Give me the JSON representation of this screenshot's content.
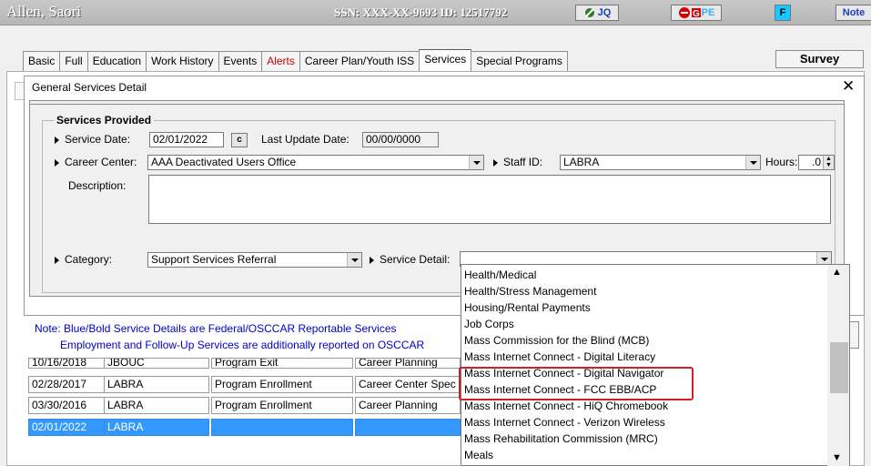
{
  "header": {
    "name": "Allen, Saori",
    "ssn_id": "SSN:  XXX-XX-9693 ID: 12517792",
    "btn_jq": "JQ",
    "btn_pe": "PE",
    "btn_f": "F",
    "btn_notes": "Note"
  },
  "tabs": [
    "Basic",
    "Full",
    "Education",
    "Work History",
    "Events",
    "Alerts",
    "Career Plan/Youth ISS",
    "Services",
    "Special Programs"
  ],
  "survey_label": "Survey",
  "dialog": {
    "title": "General Services Detail",
    "close": "✕",
    "group_title": "Services Provided",
    "service_date_label": "Service Date:",
    "service_date_value": "02/01/2022",
    "cal_btn": "c",
    "last_update_label": "Last Update Date:",
    "last_update_value": "00/00/0000",
    "career_center_label": "Career Center:",
    "career_center_value": "AAA Deactivated Users Office",
    "staff_label": "Staff ID:",
    "staff_value": "LABRA",
    "hours_label": "Hours:",
    "hours_value": ".0",
    "description_label": "Description:",
    "description_value": "",
    "category_label": "Category:",
    "category_value": "Support Services Referral",
    "service_detail_label": "Service Detail:",
    "service_detail_value": ""
  },
  "notes": [
    "Note: Blue/Bold Service Details are Federal/OSCCAR Reportable Services",
    "Employment and Follow-Up Services are additionally reported on OSCCAR"
  ],
  "grid_rows": [
    {
      "date": "10/16/2018",
      "staff": "JBOUC",
      "type": "Program Exit",
      "cat": "Career Planning"
    },
    {
      "date": "02/28/2017",
      "staff": "LABRA",
      "type": "Program Enrollment",
      "cat": "Career Center Spec"
    },
    {
      "date": "03/30/2016",
      "staff": "LABRA",
      "type": "Program Enrollment",
      "cat": "Career Planning"
    },
    {
      "date": "02/01/2022",
      "staff": "LABRA",
      "type": "",
      "cat": ""
    }
  ],
  "dropdown_items": [
    "Health/Medical",
    "Health/Stress Management",
    "Housing/Rental Payments",
    "Job Corps",
    "Mass Commission for the Blind (MCB)",
    "Mass Internet Connect - Digital Literacy",
    "Mass Internet Connect - Digital Navigator",
    "Mass Internet Connect - FCC EBB/ACP",
    "Mass Internet Connect - HiQ Chromebook",
    "Mass Internet Connect - Verizon Wireless",
    "Mass Rehabilitation Commission (MRC)",
    "Meals"
  ],
  "colors": {
    "selection": "#3399ff",
    "highlight_box": "#c8232c",
    "note_text": "#0000cc",
    "alert_tab": "#d10000"
  },
  "icons": [
    "jq-icon",
    "pe-icon",
    "scroll-up-icon",
    "scroll-down-icon",
    "dropdown-arrow-icon"
  ]
}
